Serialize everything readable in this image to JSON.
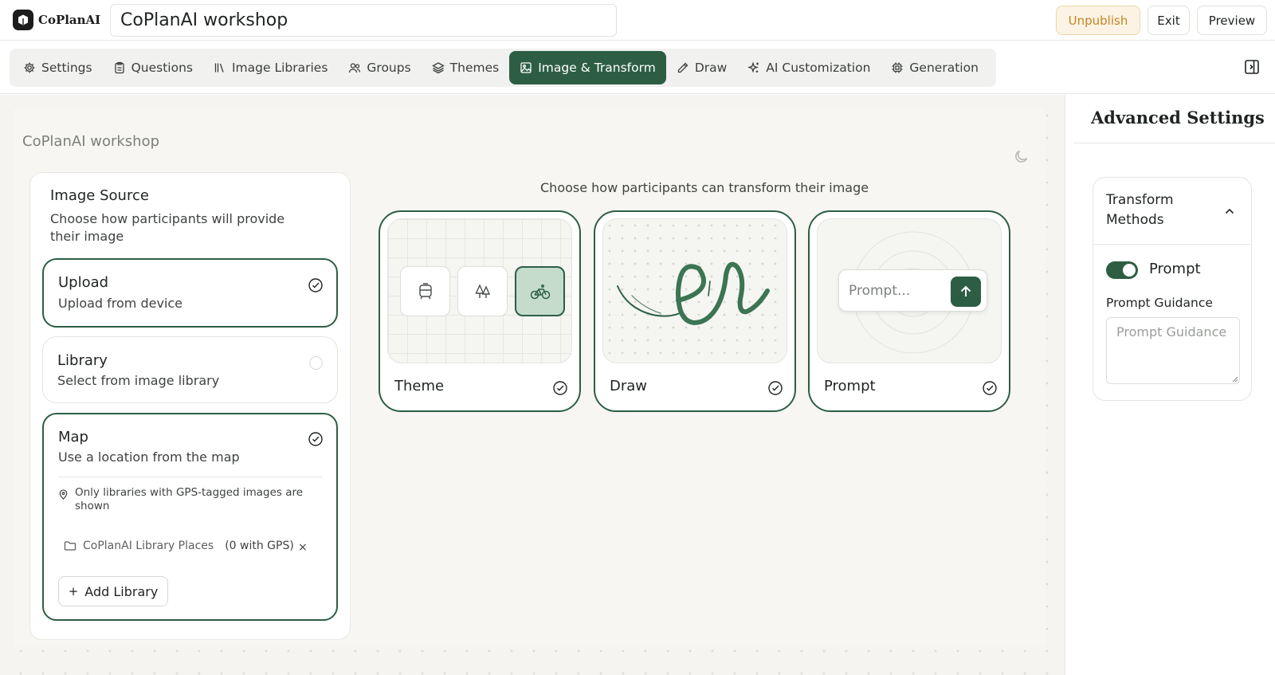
{
  "app": {
    "logo_text": "CoPlanAI",
    "title_value": "CoPlanAI workshop"
  },
  "actions": {
    "unpublish": "Unpublish",
    "exit": "Exit",
    "preview": "Preview"
  },
  "tabs": [
    {
      "label": "Settings",
      "icon": "gear-icon"
    },
    {
      "label": "Questions",
      "icon": "clipboard-icon"
    },
    {
      "label": "Image Libraries",
      "icon": "library-icon"
    },
    {
      "label": "Groups",
      "icon": "users-icon"
    },
    {
      "label": "Themes",
      "icon": "layers-icon"
    },
    {
      "label": "Image & Transform",
      "icon": "image-icon",
      "active": true
    },
    {
      "label": "Draw",
      "icon": "pencil-icon"
    },
    {
      "label": "AI Customization",
      "icon": "sparkles-icon"
    },
    {
      "label": "Generation",
      "icon": "cpu-icon"
    }
  ],
  "canvas": {
    "title": "CoPlanAI workshop"
  },
  "image_source": {
    "title": "Image Source",
    "description": "Choose how participants will provide their image",
    "options": [
      {
        "title": "Upload",
        "subtitle": "Upload from device",
        "selected": true
      },
      {
        "title": "Library",
        "subtitle": "Select from image library",
        "selected": false
      },
      {
        "title": "Map",
        "subtitle": "Use a location from the map",
        "selected": true
      }
    ],
    "map_note": "Only libraries with GPS-tagged images are shown",
    "library_name": "CoPlanAI Library Places",
    "library_count": "(0 with GPS)",
    "remove_symbol": "×",
    "add_library": "Add Library"
  },
  "transform": {
    "caption": "Choose how participants can transform their image",
    "cards": [
      {
        "label": "Theme",
        "selected": true
      },
      {
        "label": "Draw",
        "selected": true
      },
      {
        "label": "Prompt",
        "selected": true
      }
    ],
    "prompt_placeholder": "Prompt..."
  },
  "advanced": {
    "title": "Advanced Settings",
    "section": "Transform Methods",
    "toggle_label": "Prompt",
    "toggle_on": true,
    "guidance_label": "Prompt Guidance",
    "guidance_placeholder": "Prompt Guidance"
  },
  "colors": {
    "accent": "#2d5e44",
    "warning": "#c48524"
  }
}
